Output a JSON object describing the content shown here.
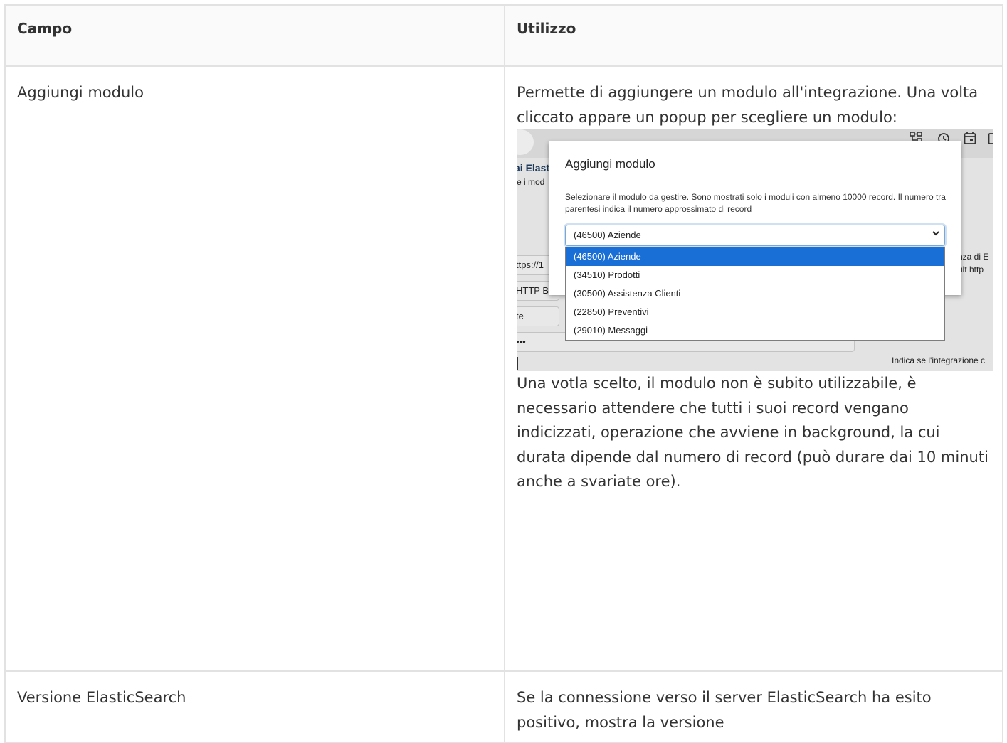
{
  "table": {
    "headers": [
      "Campo",
      "Utilizzo"
    ],
    "rows": [
      {
        "field": "Aggiungi modulo",
        "usage_intro": "Permette di aggiungere un modulo all'integrazione. Una volta cliccato appare un popup per scegliere un modulo:",
        "usage_after": "Una votla scelto, il modulo non è subito utilizzabile, è necessario attendere che tutti i suoi record vengano indicizzati, operazione che avviene in background, la cui durata dipende dal numero di record (può durare dai 10 minuti anche a svariate ore)."
      },
      {
        "field": "Versione ElasticSearch",
        "usage_intro": "Se la connessione verso il server ElasticSearch ha esito positivo, mostra la versione"
      }
    ]
  },
  "screenshot": {
    "toolbar_icons": [
      "sitemap-icon",
      "history-icon",
      "calendar-icon",
      "panel-icon"
    ],
    "background": {
      "title_fragment": "ai Elast",
      "subtitle_fragment": "e i mod",
      "input1": "ttps://1",
      "input2": "HTTP Ba",
      "input3": "te",
      "input4": "•••",
      "right_text1": "nza di E",
      "right_text2": "ult http",
      "bottom_right": "Indica se l'integrazione c"
    },
    "modal": {
      "title": "Aggiungi modulo",
      "description": "Selezionare il modulo da gestire. Sono mostrati solo i moduli con almeno 10000 record. Il numero tra parentesi indica il numero approssimato di record",
      "selected": "(46500) Aziende",
      "options": [
        "(46500) Aziende",
        "(34510) Prodotti",
        "(30500) Assistenza Clienti",
        "(22850) Preventivi",
        "(29010) Messaggi"
      ]
    }
  }
}
